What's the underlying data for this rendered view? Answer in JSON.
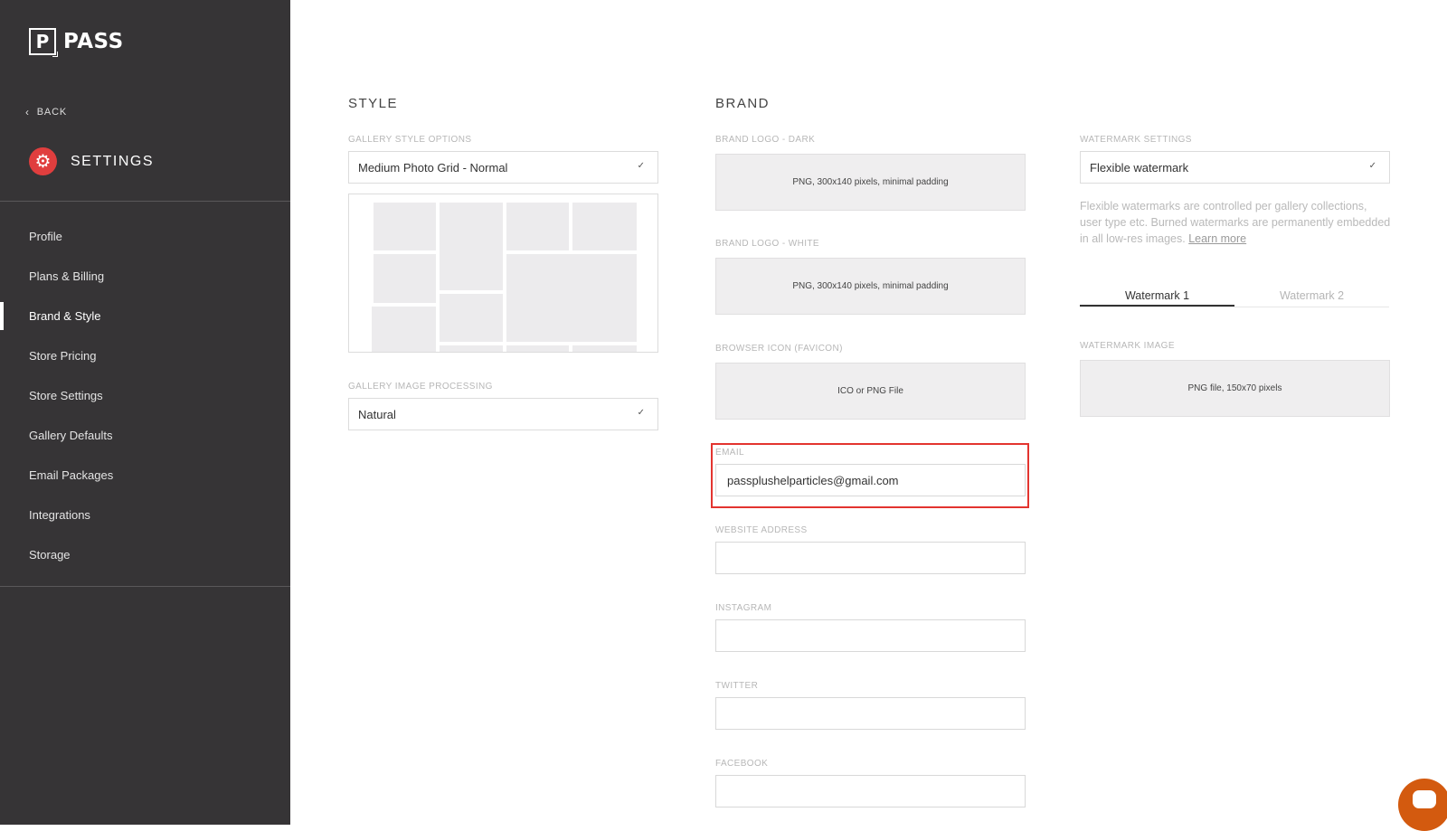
{
  "sidebar": {
    "logo_letter": "P",
    "logo_text": "PASS",
    "back_label": "BACK",
    "section_title": "SETTINGS",
    "items": [
      {
        "label": "Profile"
      },
      {
        "label": "Plans & Billing"
      },
      {
        "label": "Brand & Style",
        "active": true
      },
      {
        "label": "Store Pricing"
      },
      {
        "label": "Store Settings"
      },
      {
        "label": "Gallery Defaults"
      },
      {
        "label": "Email Packages"
      },
      {
        "label": "Integrations"
      },
      {
        "label": "Storage"
      }
    ]
  },
  "style": {
    "title": "STYLE",
    "gallery_style_label": "GALLERY STYLE OPTIONS",
    "gallery_style_value": "Medium Photo Grid - Normal",
    "processing_label": "GALLERY IMAGE PROCESSING",
    "processing_value": "Natural"
  },
  "brand": {
    "title": "BRAND",
    "logo_dark_label": "BRAND LOGO - DARK",
    "logo_dark_hint": "PNG, 300x140 pixels, minimal padding",
    "logo_white_label": "BRAND LOGO - WHITE",
    "logo_white_hint": "PNG, 300x140 pixels, minimal padding",
    "favicon_label": "BROWSER ICON (FAVICON)",
    "favicon_hint": "ICO or PNG File",
    "email_label": "EMAIL",
    "email_value": "passplushelparticles@gmail.com",
    "website_label": "WEBSITE ADDRESS",
    "website_value": "",
    "instagram_label": "INSTAGRAM",
    "instagram_value": "",
    "twitter_label": "TWITTER",
    "twitter_value": "",
    "facebook_label": "FACEBOOK",
    "facebook_value": ""
  },
  "watermark": {
    "settings_label": "WATERMARK SETTINGS",
    "settings_value": "Flexible watermark",
    "description": "Flexible watermarks are controlled per gallery collections, user type etc. Burned watermarks are permanently embedded in all low-res images.",
    "learn_more": "Learn more",
    "tab1": "Watermark 1",
    "tab2": "Watermark 2",
    "image_label": "WATERMARK IMAGE",
    "image_hint": "PNG file, 150x70 pixels"
  },
  "icons": {
    "caret": "✓",
    "back_chevron": "‹",
    "gear": "⚙"
  },
  "colors": {
    "sidebar_bg": "#363436",
    "accent_red": "#e03e3e",
    "highlight": "#e3342f",
    "chat": "#d35a0f"
  }
}
